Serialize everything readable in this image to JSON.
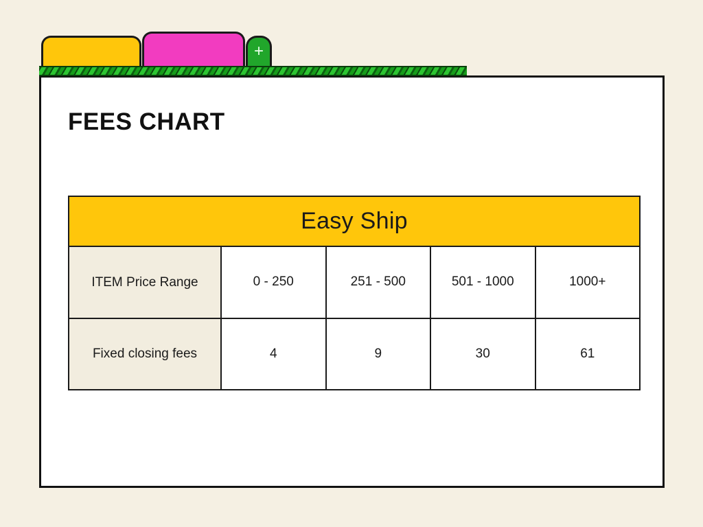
{
  "window": {
    "tabs": [
      {
        "name": "tab-one",
        "label": "",
        "color": "#ffc60b"
      },
      {
        "name": "tab-two",
        "label": "",
        "color": "#f23cc0"
      }
    ],
    "new_tab_button": {
      "icon": "plus-icon",
      "glyph": "+",
      "color": "#21a62b"
    },
    "rail_color": "#17a81c",
    "panel_background": "#ffffff",
    "page_background": "#f5f0e3"
  },
  "page": {
    "title": "FEES CHART"
  },
  "chart_data": {
    "type": "table",
    "title": "Easy Ship",
    "header": "Easy Ship",
    "row_labels": [
      "ITEM Price Range",
      "Fixed closing fees"
    ],
    "categories": [
      "0 - 250",
      "251 - 500",
      "501 - 1000",
      "1000+"
    ],
    "values": [
      4,
      9,
      30,
      61
    ],
    "series": [
      {
        "name": "Fixed closing fees",
        "values": [
          4,
          9,
          30,
          61
        ]
      }
    ],
    "xlabel": "ITEM Price Range",
    "ylabel": "Fixed closing fees",
    "accent_color": "#ffc60b",
    "label_cell_color": "#f2eddf"
  },
  "table": {
    "header_label": "Easy Ship",
    "rows": [
      {
        "label": "ITEM Price Range",
        "cells": [
          "0 - 250",
          "251 - 500",
          "501 - 1000",
          "1000+"
        ]
      },
      {
        "label": "Fixed closing fees",
        "cells": [
          "4",
          "9",
          "30",
          "61"
        ]
      }
    ]
  }
}
